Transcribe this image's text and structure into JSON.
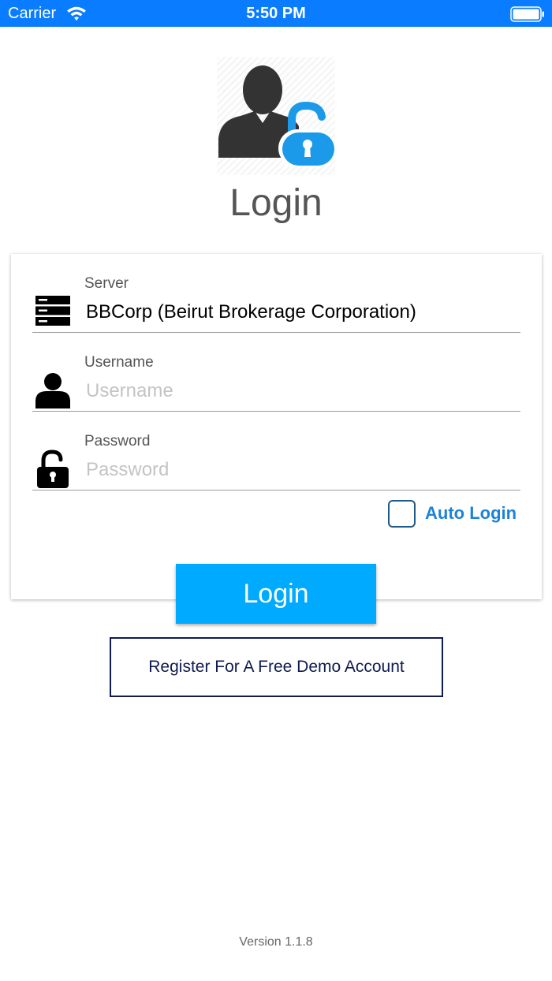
{
  "status_bar": {
    "carrier": "Carrier",
    "time": "5:50 PM",
    "background_color": "#0a7cff"
  },
  "header": {
    "logo_icon": "user-lock-icon",
    "title": "Login"
  },
  "form": {
    "server": {
      "label": "Server",
      "value": "BBCorp (Beirut Brokerage Corporation)",
      "icon": "server-icon"
    },
    "username": {
      "label": "Username",
      "value": "",
      "placeholder": "Username",
      "icon": "user-icon"
    },
    "password": {
      "label": "Password",
      "value": "",
      "placeholder": "Password",
      "icon": "unlock-icon"
    },
    "auto_login": {
      "label": "Auto Login",
      "checked": false,
      "accent_color": "#1c83d8"
    }
  },
  "actions": {
    "login_label": "Login",
    "login_color": "#00aaff",
    "register_label": "Register For A Free Demo Account",
    "register_color": "#0f1a4f"
  },
  "footer": {
    "version": "Version 1.1.8"
  }
}
